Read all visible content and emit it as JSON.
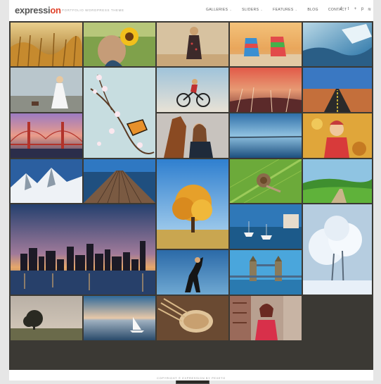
{
  "header": {
    "logo_prefix": "expressi",
    "logo_accent": "on",
    "tagline": "Portfolio WordPress Theme"
  },
  "nav": {
    "items": [
      {
        "label": "Galleries",
        "has_dropdown": true
      },
      {
        "label": "Sliders",
        "has_dropdown": true
      },
      {
        "label": "Features",
        "has_dropdown": true
      },
      {
        "label": "Blog",
        "has_dropdown": false
      },
      {
        "label": "Contact",
        "has_dropdown": false
      }
    ],
    "caret": "⌄"
  },
  "social": {
    "icons": [
      {
        "name": "facebook-icon",
        "glyph": "f"
      },
      {
        "name": "twitter-icon",
        "glyph": "t"
      },
      {
        "name": "google-plus-icon",
        "glyph": "+"
      },
      {
        "name": "pinterest-icon",
        "glyph": "p"
      },
      {
        "name": "rss-icon",
        "glyph": "≋"
      }
    ]
  },
  "gallery": {
    "photos": [
      "wheat-field",
      "girl-sunflower",
      "woman-dress",
      "beach-chairs",
      "ocean-waves",
      "bride-beach",
      "blossom-butterfly",
      "cyclist",
      "sunset-grass",
      "desert-road",
      "golden-gate-bridge",
      "woman-horse",
      "calm-lake",
      "child-autumn",
      "snowy-mountains",
      "wooden-pier",
      "autumn-tree",
      "snail-leaf",
      "green-hills",
      "city-skyline-night",
      "harbor-boats",
      "snowy-trees",
      "rearing-horse",
      "tower-bridge",
      "lone-tree",
      "sailboat",
      "bread-oats",
      "woman-red-scarf"
    ]
  },
  "load_more_label": "Load More",
  "footer": {
    "text": "Copyright © Expression by Pexeto"
  },
  "colors": {
    "accent": "#e0432b",
    "gallery_bg": "#3b3934"
  }
}
